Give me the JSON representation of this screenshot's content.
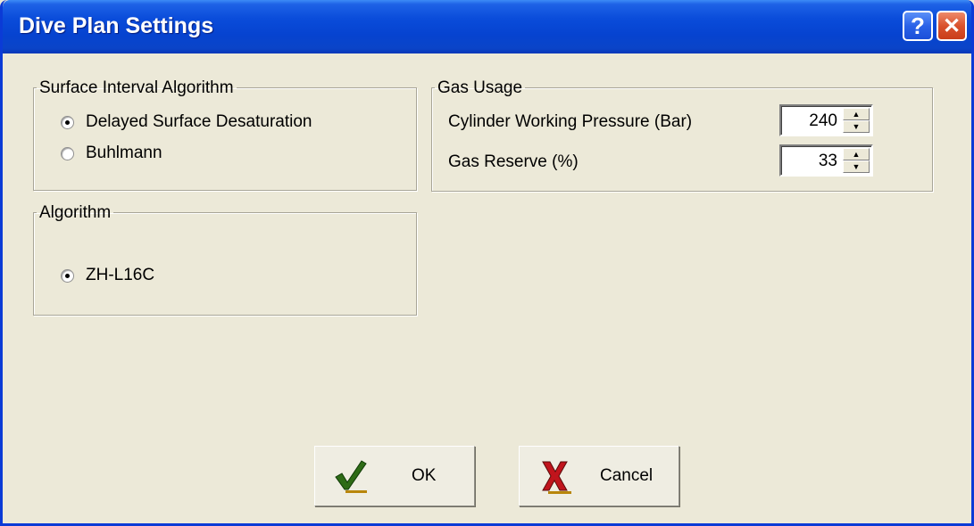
{
  "window": {
    "title": "Dive Plan Settings",
    "help_glyph": "?",
    "close_glyph": "✕"
  },
  "surface_interval": {
    "legend": "Surface Interval Algorithm",
    "options": [
      {
        "label": "Delayed Surface Desaturation",
        "checked": true
      },
      {
        "label": "Buhlmann",
        "checked": false
      }
    ]
  },
  "algorithm": {
    "legend": "Algorithm",
    "options": [
      {
        "label": "ZH-L16C",
        "checked": true
      }
    ]
  },
  "gas_usage": {
    "legend": "Gas Usage",
    "cylinder_pressure_label": "Cylinder Working Pressure (Bar)",
    "cylinder_pressure_value": "240",
    "gas_reserve_label": "Gas Reserve (%)",
    "gas_reserve_value": "33"
  },
  "buttons": {
    "ok_label": "OK",
    "cancel_label": "Cancel"
  },
  "icons": {
    "help": "help-icon",
    "close": "close-icon",
    "ok": "checkmark-icon",
    "cancel": "red-x-icon",
    "spin_up": "arrow-up-icon",
    "spin_down": "arrow-down-icon"
  },
  "colors": {
    "titlebar": "#0A4CDA",
    "dialog_bg": "#ECE9D8",
    "ok_check": "#2E6B16",
    "cancel_x": "#C0141C"
  }
}
